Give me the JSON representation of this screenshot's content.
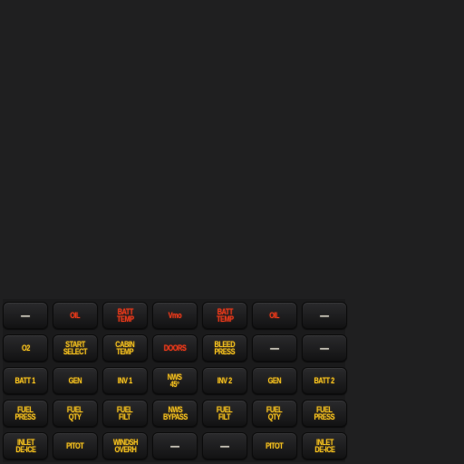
{
  "annunciator_panel": {
    "rows": [
      [
        {
          "label": "—",
          "color": "#f3efe2"
        },
        {
          "label": "OIL",
          "color": "#ef3a1a"
        },
        {
          "label": "BATT\nTEMP",
          "color": "#ef3a1a"
        },
        {
          "label": "Vmo",
          "color": "#ef3a1a"
        },
        {
          "label": "BATT\nTEMP",
          "color": "#ef3a1a"
        },
        {
          "label": "OIL",
          "color": "#ef3a1a"
        },
        {
          "label": "—",
          "color": "#f3efe2"
        }
      ],
      [
        {
          "label": "O2",
          "color": "#f2c11f"
        },
        {
          "label": "START\nSELECT",
          "color": "#f2c11f"
        },
        {
          "label": "CABIN\nTEMP",
          "color": "#f2c11f"
        },
        {
          "label": "DOORS",
          "color": "#ef3a1a"
        },
        {
          "label": "BLEED\nPRESS",
          "color": "#f2c11f"
        },
        {
          "label": "—",
          "color": "#f3efe2"
        },
        {
          "label": "—",
          "color": "#f3efe2"
        }
      ],
      [
        {
          "label": "BATT 1",
          "color": "#f2c11f"
        },
        {
          "label": "GEN",
          "color": "#f2c11f"
        },
        {
          "label": "INV 1",
          "color": "#f2c11f"
        },
        {
          "label": "NWS\n45°",
          "color": "#f2c11f"
        },
        {
          "label": "INV 2",
          "color": "#f2c11f"
        },
        {
          "label": "GEN",
          "color": "#f2c11f"
        },
        {
          "label": "BATT 2",
          "color": "#f2c11f"
        }
      ],
      [
        {
          "label": "FUEL\nPRESS",
          "color": "#f2c11f"
        },
        {
          "label": "FUEL\nQTY",
          "color": "#f2c11f"
        },
        {
          "label": "FUEL\nFILT",
          "color": "#f2c11f"
        },
        {
          "label": "NWS\nBYPASS",
          "color": "#f2c11f"
        },
        {
          "label": "FUEL\nFILT",
          "color": "#f2c11f"
        },
        {
          "label": "FUEL\nQTY",
          "color": "#f2c11f"
        },
        {
          "label": "FUEL\nPRESS",
          "color": "#f2c11f"
        }
      ],
      [
        {
          "label": "INLET\nDE-ICE",
          "color": "#f2c11f"
        },
        {
          "label": "PITOT",
          "color": "#f2c11f"
        },
        {
          "label": "WINDSH\nOVERH",
          "color": "#f2c11f"
        },
        {
          "label": "—",
          "color": "#f3efe2"
        },
        {
          "label": "—",
          "color": "#f3efe2"
        },
        {
          "label": "PITOT",
          "color": "#f2c11f"
        },
        {
          "label": "INLET\nDE-ICE",
          "color": "#f2c11f"
        }
      ]
    ]
  }
}
